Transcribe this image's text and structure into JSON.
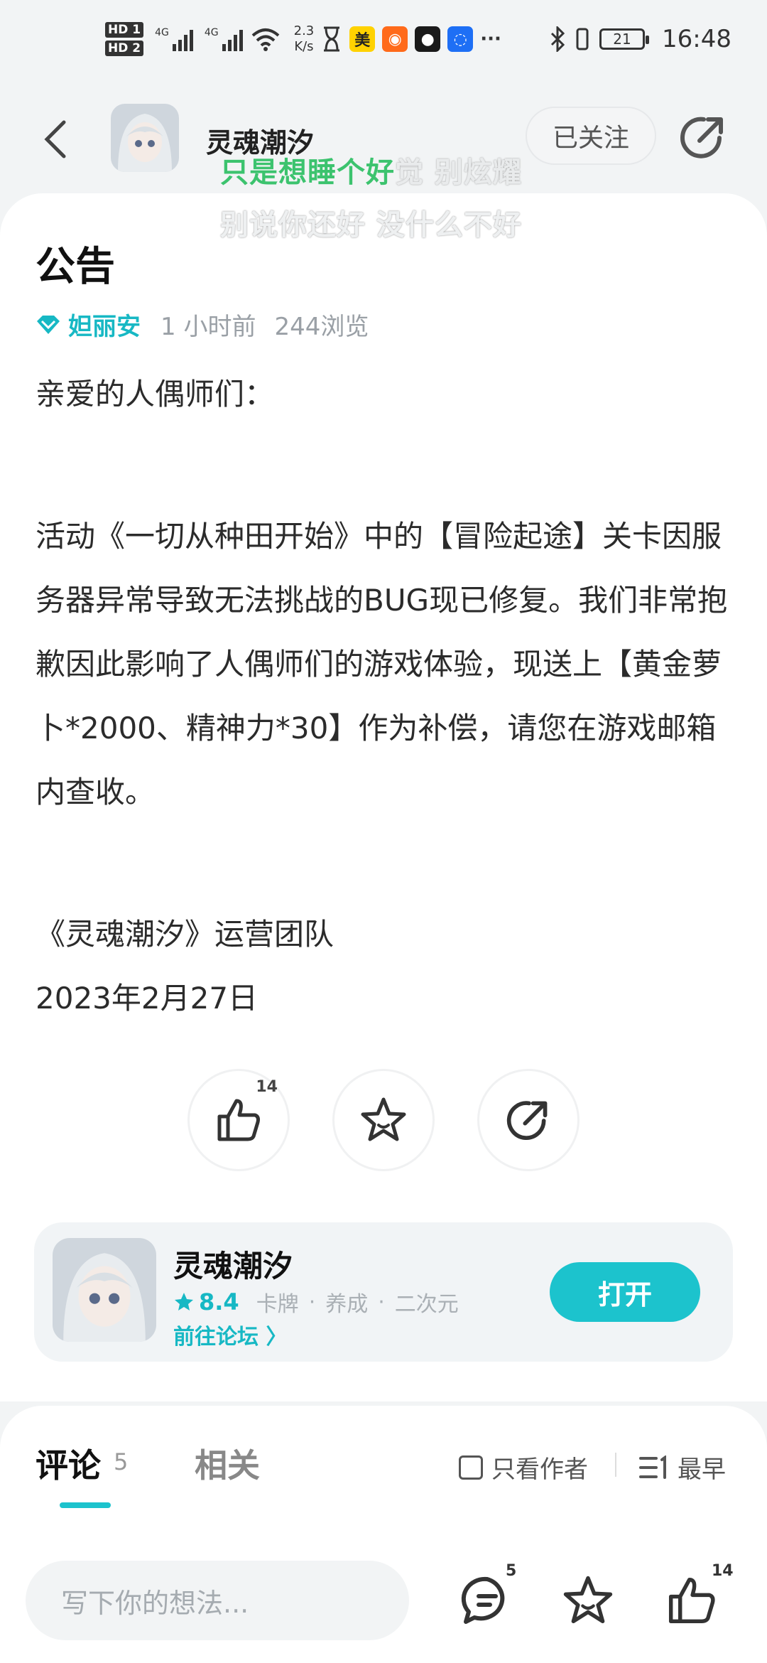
{
  "status_bar": {
    "hd1": "HD 1",
    "hd2": "HD 2",
    "net1": "4G",
    "net2": "4G",
    "speed_value": "2.3",
    "speed_unit": "K/s",
    "app_mei": "美",
    "battery": "21",
    "time": "16:48"
  },
  "nav": {
    "title": "灵魂潮汐",
    "follow_label": "已关注"
  },
  "lyrics": {
    "line1_highlight": "只是想睡个好",
    "line1_rest": "觉 别炫耀",
    "line2": "别说你还好 没什么不好"
  },
  "post": {
    "title": "公告",
    "author": "妲丽安",
    "time_ago": "1 小时前",
    "views": "244浏览",
    "greeting": "亲爱的人偶师们：",
    "paragraph": "活动《一切从种田开始》中的【冒险起途】关卡因服务器异常导致无法挑战的BUG现已修复。我们非常抱歉因此影响了人偶师们的游戏体验，现送上【黄金萝卜*2000、精神力*30】作为补偿，请您在游戏邮箱内查收。",
    "signature": "《灵魂潮汐》运营团队",
    "date": "2023年2月27日"
  },
  "actions": {
    "like_count": "14"
  },
  "game_card": {
    "name": "灵魂潮汐",
    "score": "8.4",
    "tag1": "卡牌",
    "tag2": "养成",
    "tag3": "二次元",
    "dot": "·",
    "forum_link": "前往论坛 〉",
    "open_label": "打开"
  },
  "comments": {
    "tab_comment": "评论",
    "count": "5",
    "tab_related": "相关",
    "only_author": "只看作者",
    "sort_label": "最早"
  },
  "bottom_bar": {
    "placeholder": "写下你的想法...",
    "comment_count": "5",
    "like_count": "14"
  },
  "colors": {
    "accent": "#1cc3cd",
    "lyric_green": "#3cc36e"
  }
}
